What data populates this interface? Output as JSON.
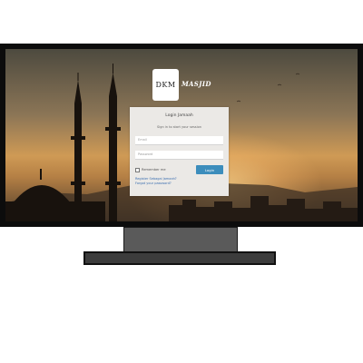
{
  "brand": {
    "logo_text": "DKM",
    "name": "MASJID"
  },
  "login": {
    "title": "Login Jamaah",
    "subtitle": "Sign in to start your session",
    "email_placeholder": "Email",
    "password_placeholder": "Password",
    "remember_label": "Remember me",
    "login_button": "Login",
    "register_link": "Register Sebagai Jamaah?",
    "forgot_link": "Forgot your password?"
  },
  "colors": {
    "accent": "#3c8dbc",
    "link": "#3c6fb0",
    "card_background": "#ebe9e6"
  }
}
